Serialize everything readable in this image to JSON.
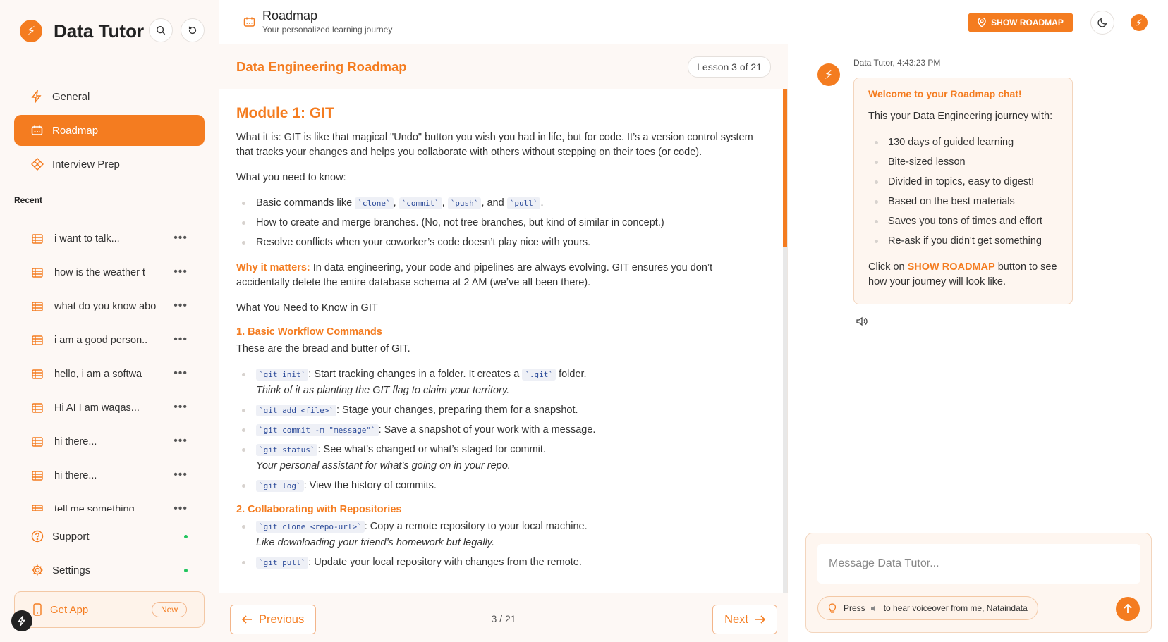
{
  "app": {
    "name": "Data Tutor"
  },
  "sidebar": {
    "nav": [
      {
        "label": "General",
        "icon": "bolt-icon"
      },
      {
        "label": "Roadmap",
        "icon": "roadmap-icon",
        "active": true
      },
      {
        "label": "Interview Prep",
        "icon": "diamond-icon"
      }
    ],
    "recent_title": "Recent",
    "recent": [
      "i want to talk...",
      "how is the weather t",
      "what do you know abo",
      "i am a good person..",
      "hello, i am a softwa",
      "Hi AI I am waqas...",
      "hi there...",
      "hi there...",
      "tell me something..."
    ],
    "support_label": "Support",
    "settings_label": "Settings",
    "get_app_label": "Get App",
    "get_app_badge": "New"
  },
  "header": {
    "title": "Roadmap",
    "subtitle": "Your personalized learning journey",
    "show_roadmap_label": "SHOW ROADMAP"
  },
  "lesson": {
    "title": "Data Engineering Roadmap",
    "counter": "Lesson 3 of 21",
    "module_title": "Module 1: GIT",
    "intro": "What it is: GIT is like that magical \"Undo\" button you wish you had in life, but for code. It’s a version control system that tracks your changes and helps you collaborate with others without stepping on their toes (or code).",
    "need_to_know_label": "What you need to know:",
    "basic_commands": {
      "text_before": "Basic commands like ",
      "c1": "`clone`",
      "sep1": ", ",
      "c2": "`commit`",
      "sep2": ", ",
      "c3": "`push`",
      "sep3": ", and ",
      "c4": "`pull`",
      "end": "."
    },
    "bullet_branches": "How to create and merge branches. (No, not tree branches, but kind of similar in concept.)",
    "bullet_conflicts": "Resolve conflicts when your coworker’s code doesn’t play nice with yours.",
    "why_label": "Why it matters:",
    "why_text": " In data engineering, your code and pipelines are always evolving. GIT ensures you don’t accidentally delete the entire database schema at 2 AM (we’ve all been there).",
    "need_to_know_git": "What You Need to Know in GIT",
    "section1_title": "1. Basic Workflow Commands",
    "section1_intro": "These are the bread and butter of GIT.",
    "s1_items": [
      {
        "code": "`git init`",
        "text": ": Start tracking changes in a folder. It creates a ",
        "code2": "`.git`",
        "text2": " folder.",
        "note": "Think of it as planting the GIT flag to claim your territory."
      },
      {
        "code": "`git add <file>`",
        "text": ": Stage your changes, preparing them for a snapshot."
      },
      {
        "code": "`git commit -m \"message\"`",
        "text": ": Save a snapshot of your work with a message."
      },
      {
        "code": "`git status`",
        "text": ": See what’s changed or what’s staged for commit.",
        "note": "Your personal assistant for what’s going on in your repo."
      },
      {
        "code": "`git log`",
        "text": ": View the history of commits."
      }
    ],
    "section2_title": "2. Collaborating with Repositories",
    "s2_items": [
      {
        "code": "`git clone <repo-url>`",
        "text": ": Copy a remote repository to your local machine.",
        "note": "Like downloading your friend’s homework but legally."
      },
      {
        "code": "`git pull`",
        "text": ": Update your local repository with changes from the remote."
      }
    ],
    "prev_label": "Previous",
    "next_label": "Next",
    "page_indicator": "3 / 21"
  },
  "chat": {
    "meta": "Data Tutor, 4:43:23 PM",
    "welcome": "Welcome to your Roadmap chat!",
    "intro": "This your Data Engineering journey with:",
    "features": [
      "130 days of guided learning",
      "Bite-sized lesson",
      "Divided in topics, easy to digest!",
      "Based on the best materials",
      "Saves you tons of times and effort",
      "Re-ask if you didn't get something"
    ],
    "cta_before": "Click on ",
    "cta_link": "SHOW ROADMAP",
    "cta_after": " button to see how your journey will look like.",
    "input_placeholder": "Message Data Tutor...",
    "hint_press": "Press",
    "hint_rest": "to hear voiceover from me, Nataindata"
  },
  "colors": {
    "accent": "#f47c20",
    "sidebar_bg": "#fdf8f5",
    "bubble_bg": "#fef6f0"
  }
}
